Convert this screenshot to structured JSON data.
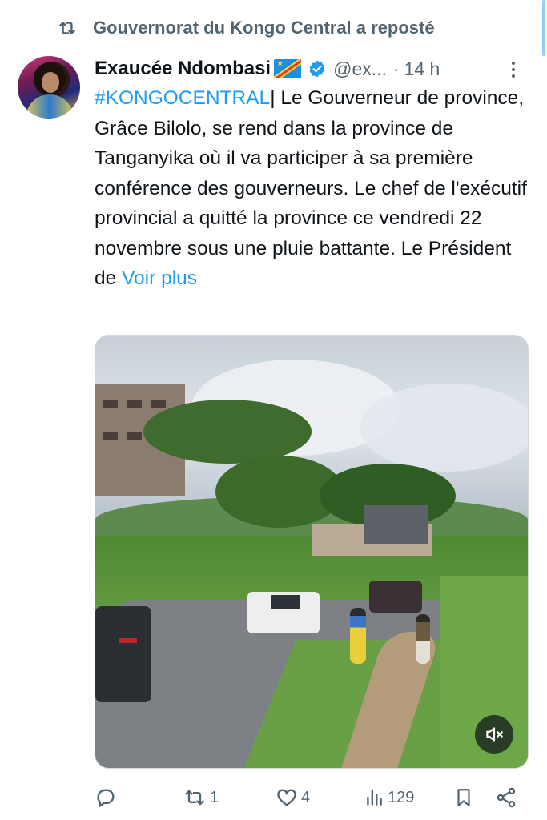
{
  "repost": {
    "label": "Gouvernorat du Kongo Central a reposté",
    "icon": "repost-icon"
  },
  "tweet": {
    "author_name": "Exaucée Ndombasi",
    "author_flag": "drc-flag-icon",
    "verified": "verified-badge-icon",
    "handle": "@ex...",
    "separator": "·",
    "time": "14 h",
    "hashtag": "#KONGOCENTRAL",
    "body": "| Le Gouverneur de province, Grâce Bilolo, se rend dans la province de Tanganyika où il va participer à sa première conférence des gouverneurs. Le chef de l'exécutif provincial a quitté la province ce vendredi 22 novembre sous une pluie battante. Le Président de ",
    "see_more": "Voir plus"
  },
  "media": {
    "type": "video",
    "mute_icon": "muted-speaker-icon"
  },
  "actions": {
    "reply": {
      "icon": "reply-icon",
      "count": ""
    },
    "retweet": {
      "icon": "retweet-icon",
      "count": "1"
    },
    "like": {
      "icon": "heart-icon",
      "count": "4"
    },
    "views": {
      "icon": "views-icon",
      "count": "129"
    },
    "bookmark": {
      "icon": "bookmark-icon"
    },
    "share": {
      "icon": "share-icon"
    }
  },
  "colors": {
    "accent": "#1d9bf0",
    "secondary_text": "#536471",
    "primary_text": "#0f1419"
  }
}
